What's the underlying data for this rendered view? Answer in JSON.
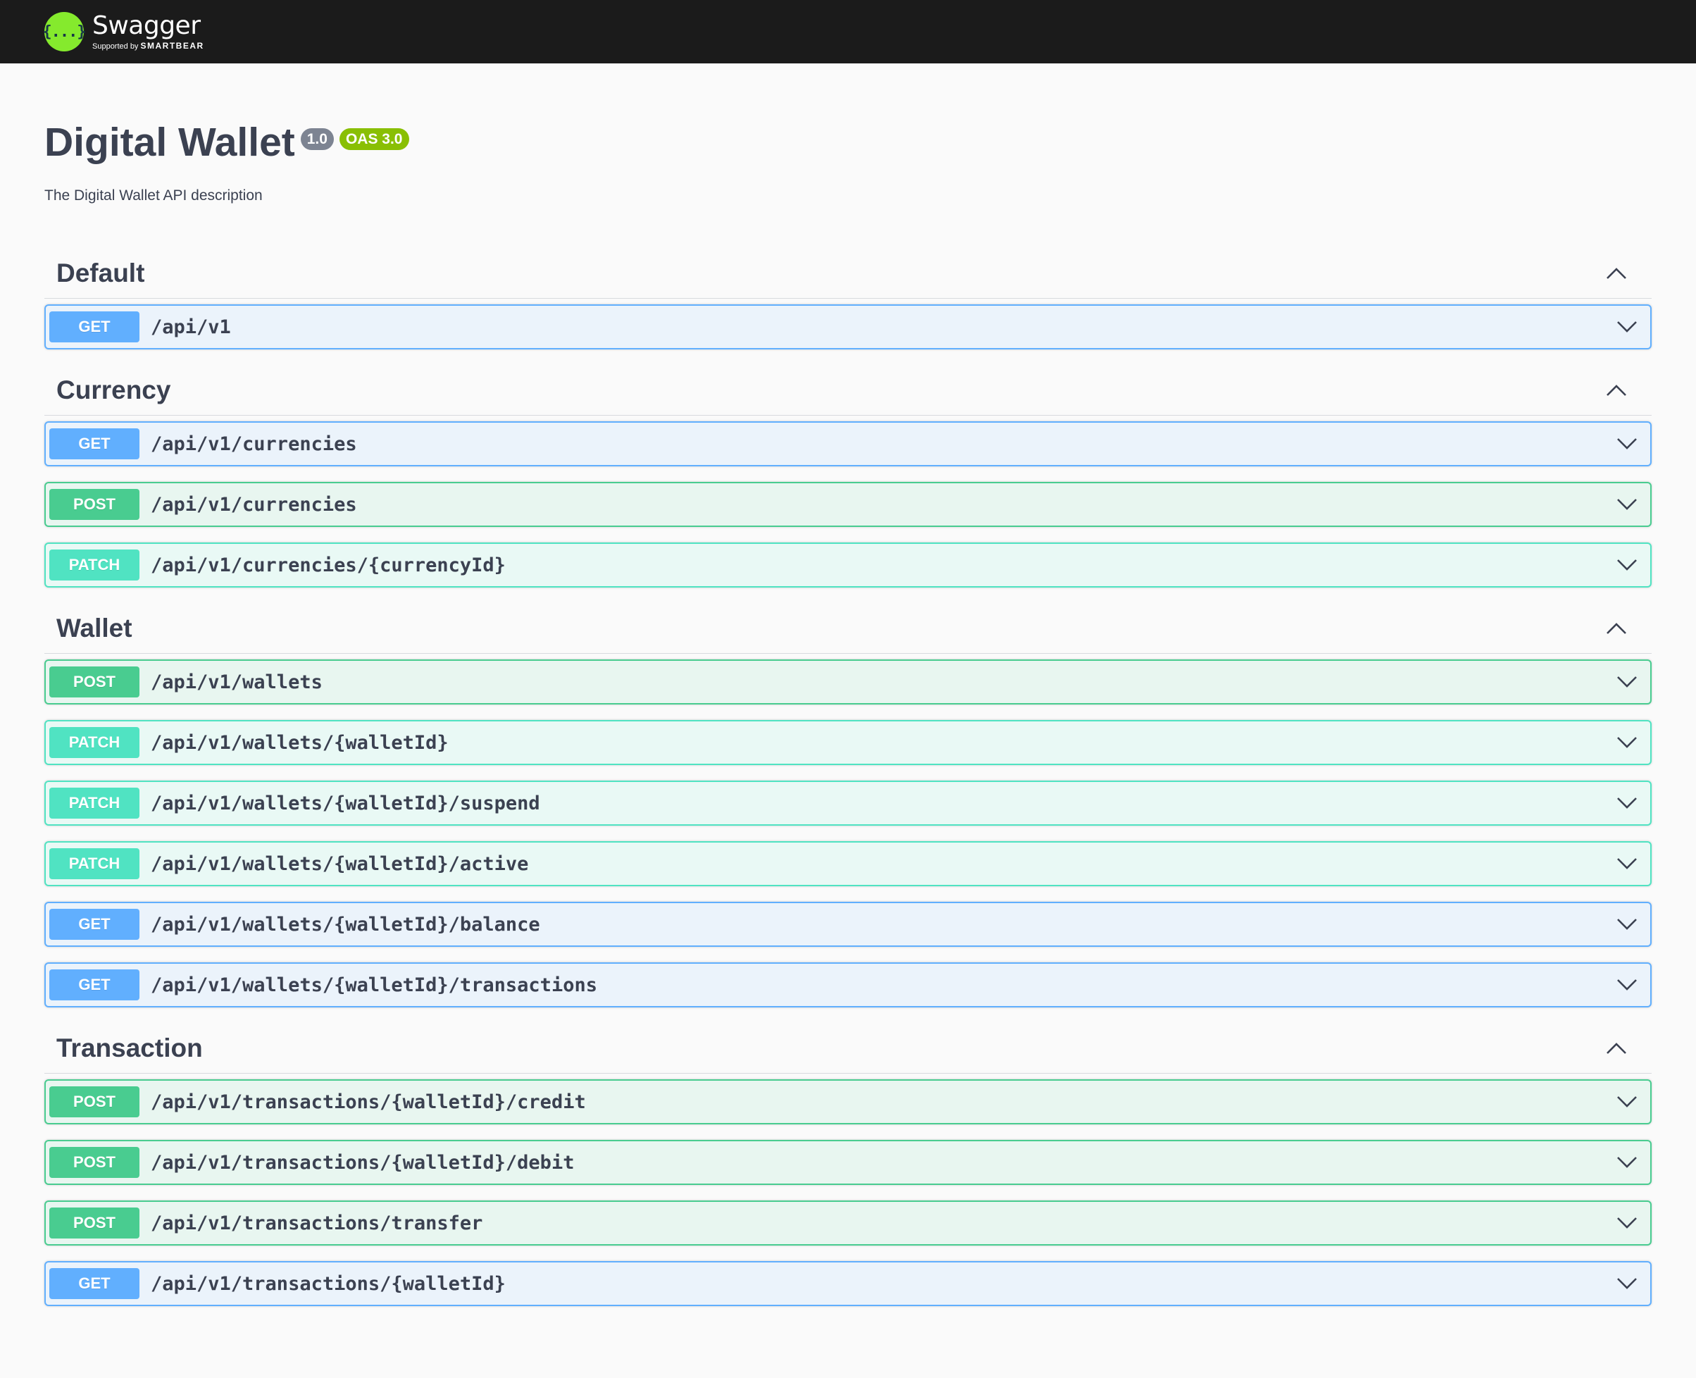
{
  "topbar": {
    "logo_symbol": "{...}",
    "logo_name": "Swagger",
    "logo_sub_prefix": "Supported by",
    "logo_sub_brand": "SMARTBEAR"
  },
  "info": {
    "title": "Digital Wallet",
    "version": "1.0",
    "oas": "OAS 3.0",
    "description": "The Digital Wallet API description"
  },
  "colors": {
    "get": "#61affe",
    "post": "#49cc90",
    "patch": "#50e3c2",
    "topbar": "#1b1b1b",
    "logo": "#85ea2d"
  },
  "icons": {
    "collapse": "chevron-up-icon",
    "expand": "chevron-down-icon"
  },
  "tags": [
    {
      "name": "Default",
      "operations": [
        {
          "method": "GET",
          "path": "/api/v1"
        }
      ]
    },
    {
      "name": "Currency",
      "operations": [
        {
          "method": "GET",
          "path": "/api/v1/currencies"
        },
        {
          "method": "POST",
          "path": "/api/v1/currencies"
        },
        {
          "method": "PATCH",
          "path": "/api/v1/currencies/{currencyId}"
        }
      ]
    },
    {
      "name": "Wallet",
      "operations": [
        {
          "method": "POST",
          "path": "/api/v1/wallets"
        },
        {
          "method": "PATCH",
          "path": "/api/v1/wallets/{walletId}"
        },
        {
          "method": "PATCH",
          "path": "/api/v1/wallets/{walletId}/suspend"
        },
        {
          "method": "PATCH",
          "path": "/api/v1/wallets/{walletId}/active"
        },
        {
          "method": "GET",
          "path": "/api/v1/wallets/{walletId}/balance"
        },
        {
          "method": "GET",
          "path": "/api/v1/wallets/{walletId}/transactions"
        }
      ]
    },
    {
      "name": "Transaction",
      "operations": [
        {
          "method": "POST",
          "path": "/api/v1/transactions/{walletId}/credit"
        },
        {
          "method": "POST",
          "path": "/api/v1/transactions/{walletId}/debit"
        },
        {
          "method": "POST",
          "path": "/api/v1/transactions/transfer"
        },
        {
          "method": "GET",
          "path": "/api/v1/transactions/{walletId}"
        }
      ]
    }
  ]
}
